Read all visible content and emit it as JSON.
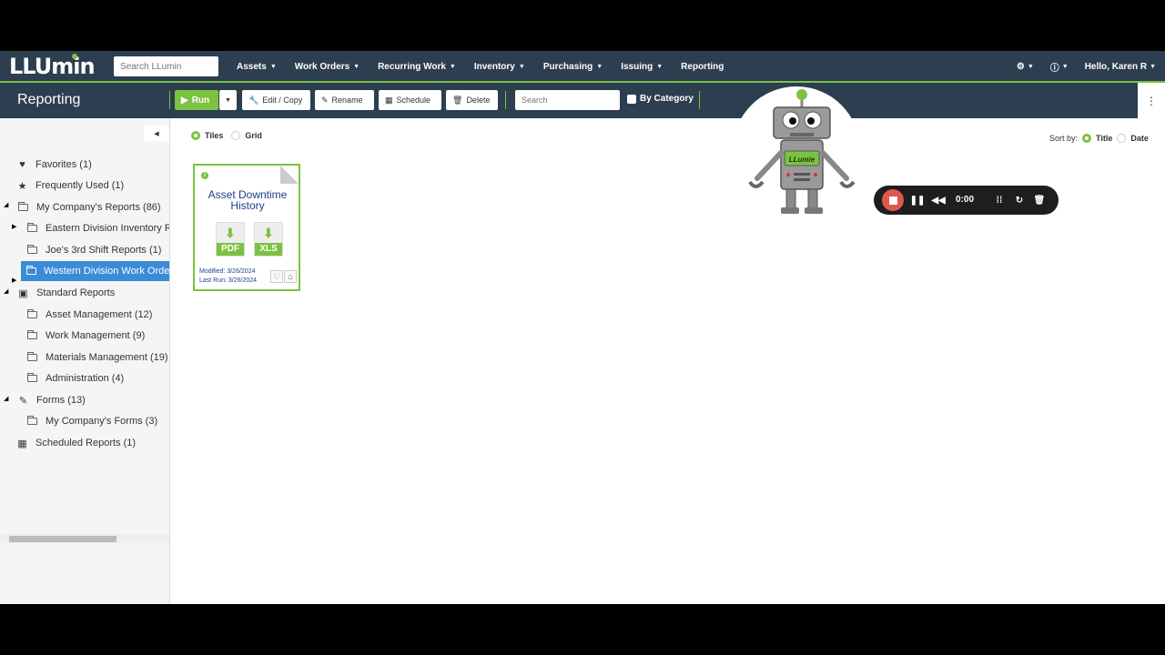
{
  "topnav": {
    "logo": "LLUmin",
    "search_placeholder": "Search LLumin",
    "menu": [
      {
        "label": "Assets"
      },
      {
        "label": "Work Orders"
      },
      {
        "label": "Recurring Work"
      },
      {
        "label": "Inventory"
      },
      {
        "label": "Purchasing"
      },
      {
        "label": "Issuing"
      },
      {
        "label": "Reporting"
      }
    ],
    "user": "Hello, Karen R"
  },
  "toolbar": {
    "title": "Reporting",
    "run": "Run",
    "edit_copy": "Edit / Copy",
    "rename": "Rename",
    "schedule": "Schedule",
    "delete": "Delete",
    "search_placeholder": "Search",
    "by_category": "By Category"
  },
  "sidebar": {
    "items": [
      {
        "label": "Favorites (1)"
      },
      {
        "label": "Frequently Used (1)"
      },
      {
        "label": "My Company's Reports (86)"
      },
      {
        "label": "Eastern Division Inventory Re"
      },
      {
        "label": "Joe's 3rd Shift Reports (1)"
      },
      {
        "label": "Western Division Work Order"
      },
      {
        "label": "Standard Reports"
      },
      {
        "label": "Asset Management (12)"
      },
      {
        "label": "Work Management (9)"
      },
      {
        "label": "Materials Management (19)"
      },
      {
        "label": "Administration (4)"
      },
      {
        "label": "Forms (13)"
      },
      {
        "label": "My Company's Forms (3)"
      },
      {
        "label": "Scheduled Reports (1)"
      }
    ]
  },
  "main": {
    "view_tiles": "Tiles",
    "view_grid": "Grid",
    "sort_label": "Sort by:",
    "sort_title": "Title",
    "sort_date": "Date",
    "tile": {
      "title": "Asset Downtime History",
      "pdf": "PDF",
      "xls": "XLS",
      "modified": "Modified: 3/26/2024",
      "last_run": "Last Run: 3/26/2024"
    }
  },
  "robot": {
    "badge": "LLumie"
  },
  "recorder": {
    "time": "0:00"
  },
  "colors": {
    "nav": "#2c3e50",
    "accent": "#7cc242",
    "selected": "#3b8bd6",
    "record": "#e0584b"
  }
}
